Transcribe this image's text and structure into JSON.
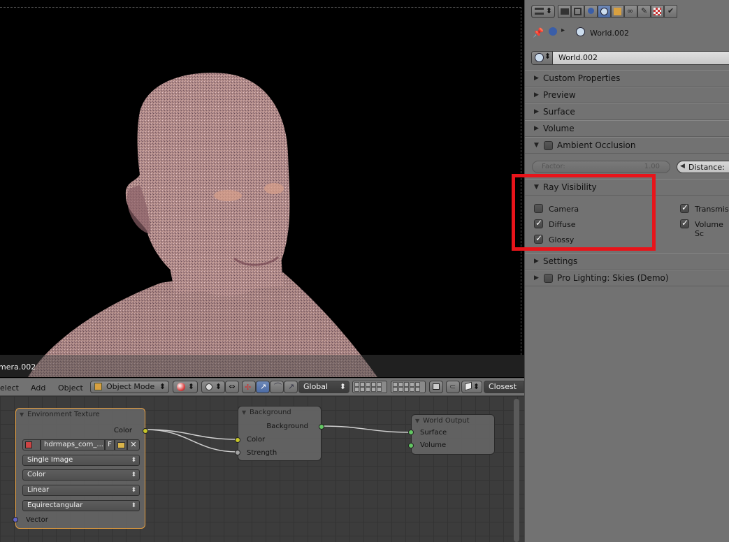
{
  "viewport": {
    "camera_label": "mera.002"
  },
  "header3d": {
    "menu": [
      "elect",
      "Add",
      "Object"
    ],
    "mode": "Object Mode",
    "orientation": "Global",
    "snap": "Closest"
  },
  "nodes": {
    "env": {
      "title": "Environment Texture",
      "out_color": "Color",
      "image_name": "hdrmaps_com_...",
      "image_flag": "F",
      "projection_type": "Single Image",
      "color_space": "Color",
      "interpolation": "Linear",
      "projection": "Equirectangular",
      "in_vector": "Vector"
    },
    "background": {
      "title": "Background",
      "out_background": "Background",
      "in_color": "Color",
      "in_strength": "Strength"
    },
    "world_output": {
      "title": "World Output",
      "in_surface": "Surface",
      "in_volume": "Volume"
    },
    "socket_colors": {
      "color": "#c7c729",
      "float": "#a1a1a1",
      "shader": "#63c763",
      "vector": "#6363c7"
    }
  },
  "props": {
    "context_world": "World.002",
    "world_selector": "World.002",
    "panels": {
      "custom_properties": "Custom Properties",
      "preview": "Preview",
      "surface": "Surface",
      "volume": "Volume",
      "ambient_occlusion": "Ambient Occlusion",
      "ray_visibility": "Ray Visibility",
      "settings": "Settings",
      "pro_lighting": "Pro Lighting: Skies (Demo)"
    },
    "ao": {
      "factor_label": "Factor:",
      "factor_value": "1.00",
      "distance_label": "Distance:"
    },
    "ray_visibility": {
      "camera": {
        "label": "Camera",
        "checked": false
      },
      "diffuse": {
        "label": "Diffuse",
        "checked": true
      },
      "glossy": {
        "label": "Glossy",
        "checked": true
      },
      "transmission": {
        "label": "Transmiss",
        "checked": true
      },
      "volume_scatter": {
        "label": "Volume Sc",
        "checked": true
      }
    },
    "highlight_color": "#e8141a"
  }
}
